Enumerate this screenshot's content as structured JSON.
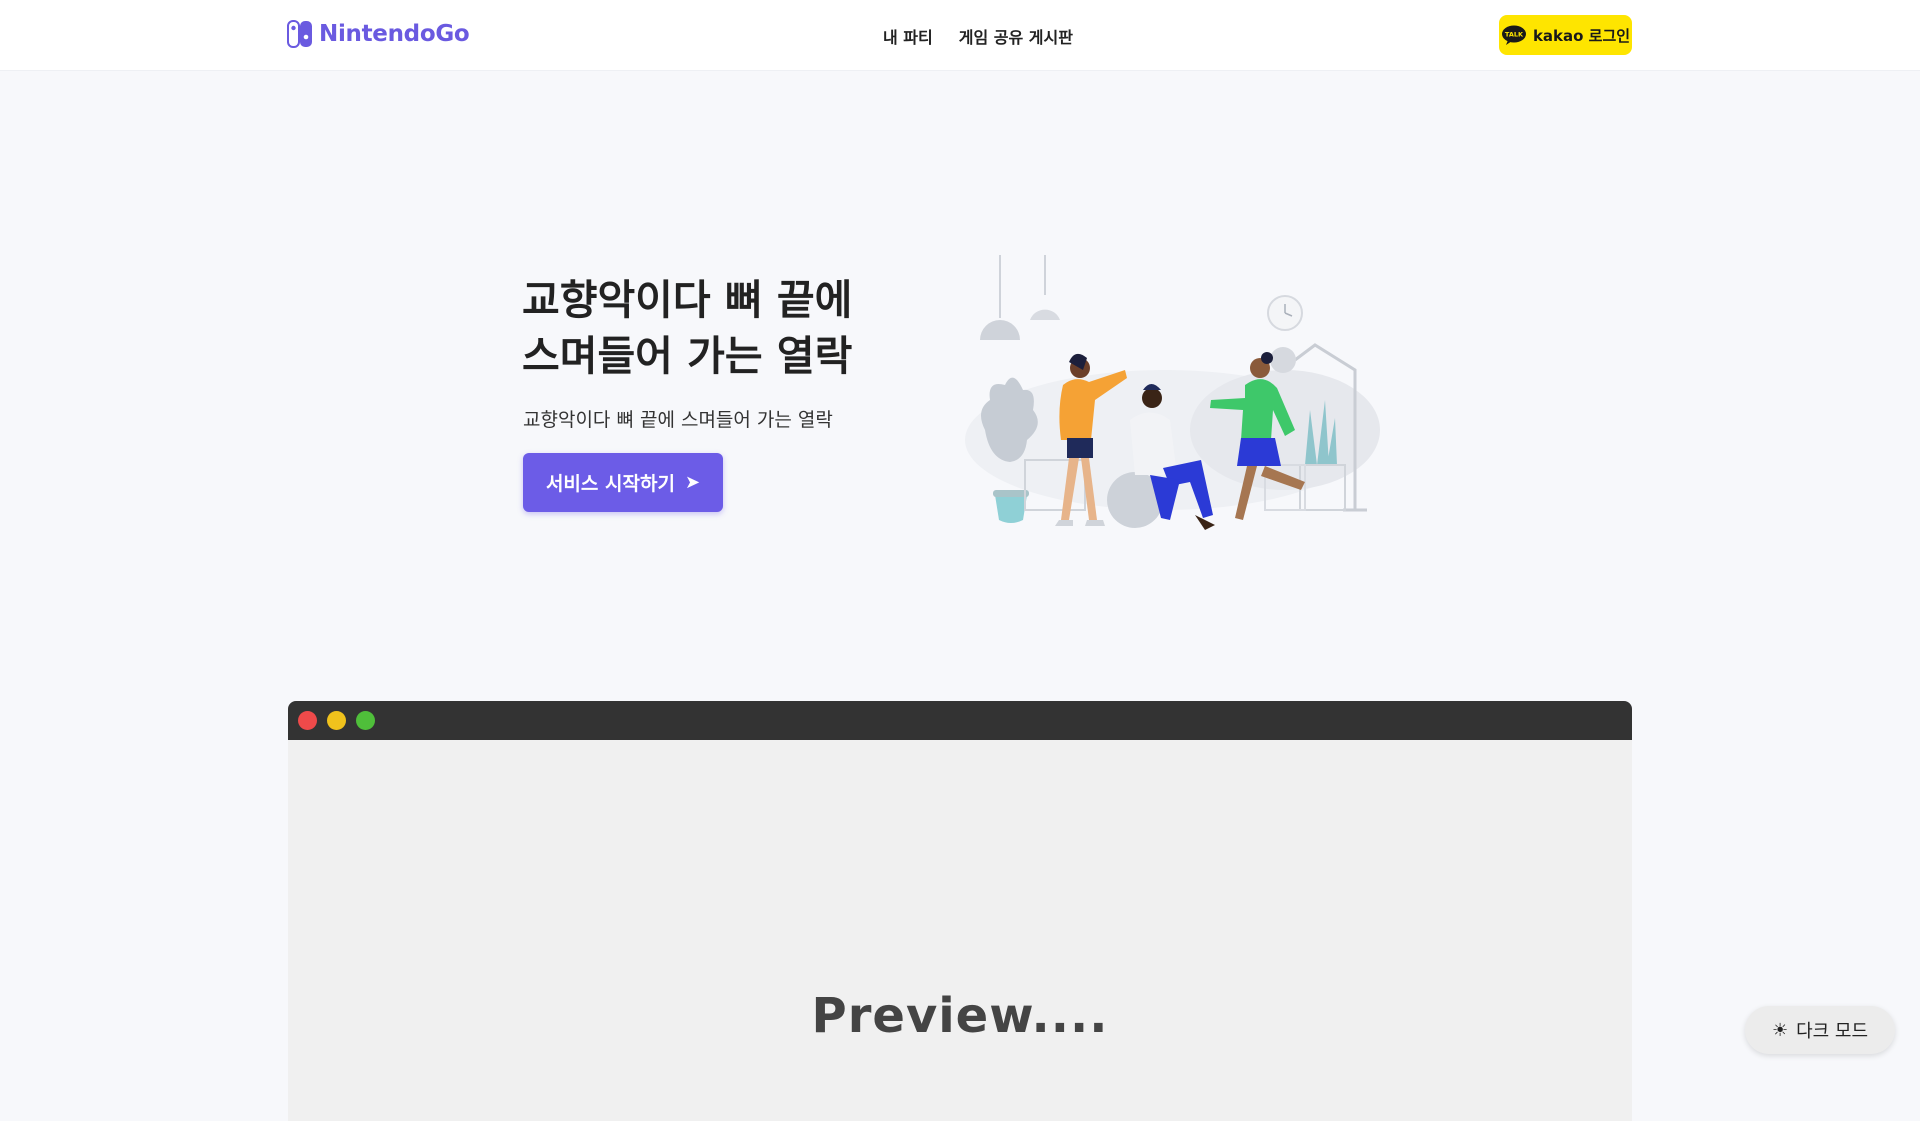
{
  "header": {
    "logo_text": "NintendoGo",
    "nav": [
      {
        "label": "내 파티"
      },
      {
        "label": "게임 공유 게시판"
      }
    ],
    "login_button": {
      "label": "kakao 로그인",
      "icon": "kakao-talk-icon",
      "color": "#fee500"
    }
  },
  "hero": {
    "title": "교향악이다 뼈 끝에\n스며들어 가는 열락",
    "subtitle": "교향악이다 뼈 끝에 스며들어 가는 열락",
    "cta_label": "서비스 시작하기",
    "cta_icon": "arrow-right-icon",
    "accent_color": "#6c5ce7"
  },
  "preview": {
    "text": "Preview....",
    "window_dots": [
      "red",
      "yellow",
      "green"
    ]
  },
  "dark_mode_toggle": {
    "label": "다크 모드",
    "icon": "sun-icon"
  }
}
